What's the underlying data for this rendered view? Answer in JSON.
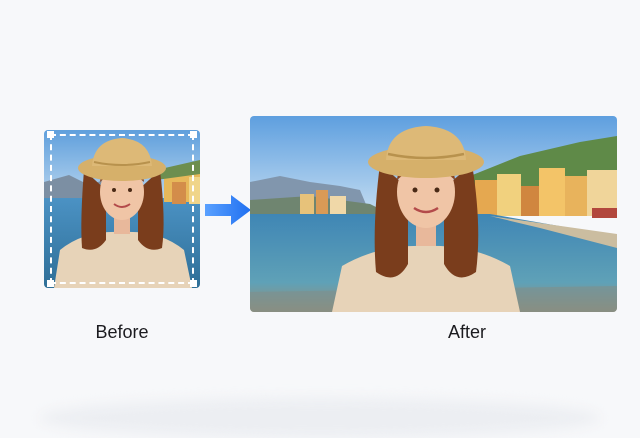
{
  "before": {
    "caption": "Before"
  },
  "after": {
    "caption": "After"
  },
  "icons": {
    "arrow": "arrow-right-icon",
    "crop_handles": "crop-handle-icon"
  },
  "colors": {
    "arrow": "#2f7bf5",
    "sky": "#6fa8dc",
    "sea": "#3f86b5",
    "hat": "#d6b06a",
    "hair": "#7a3d1c",
    "sweater": "#e7d3b8"
  }
}
